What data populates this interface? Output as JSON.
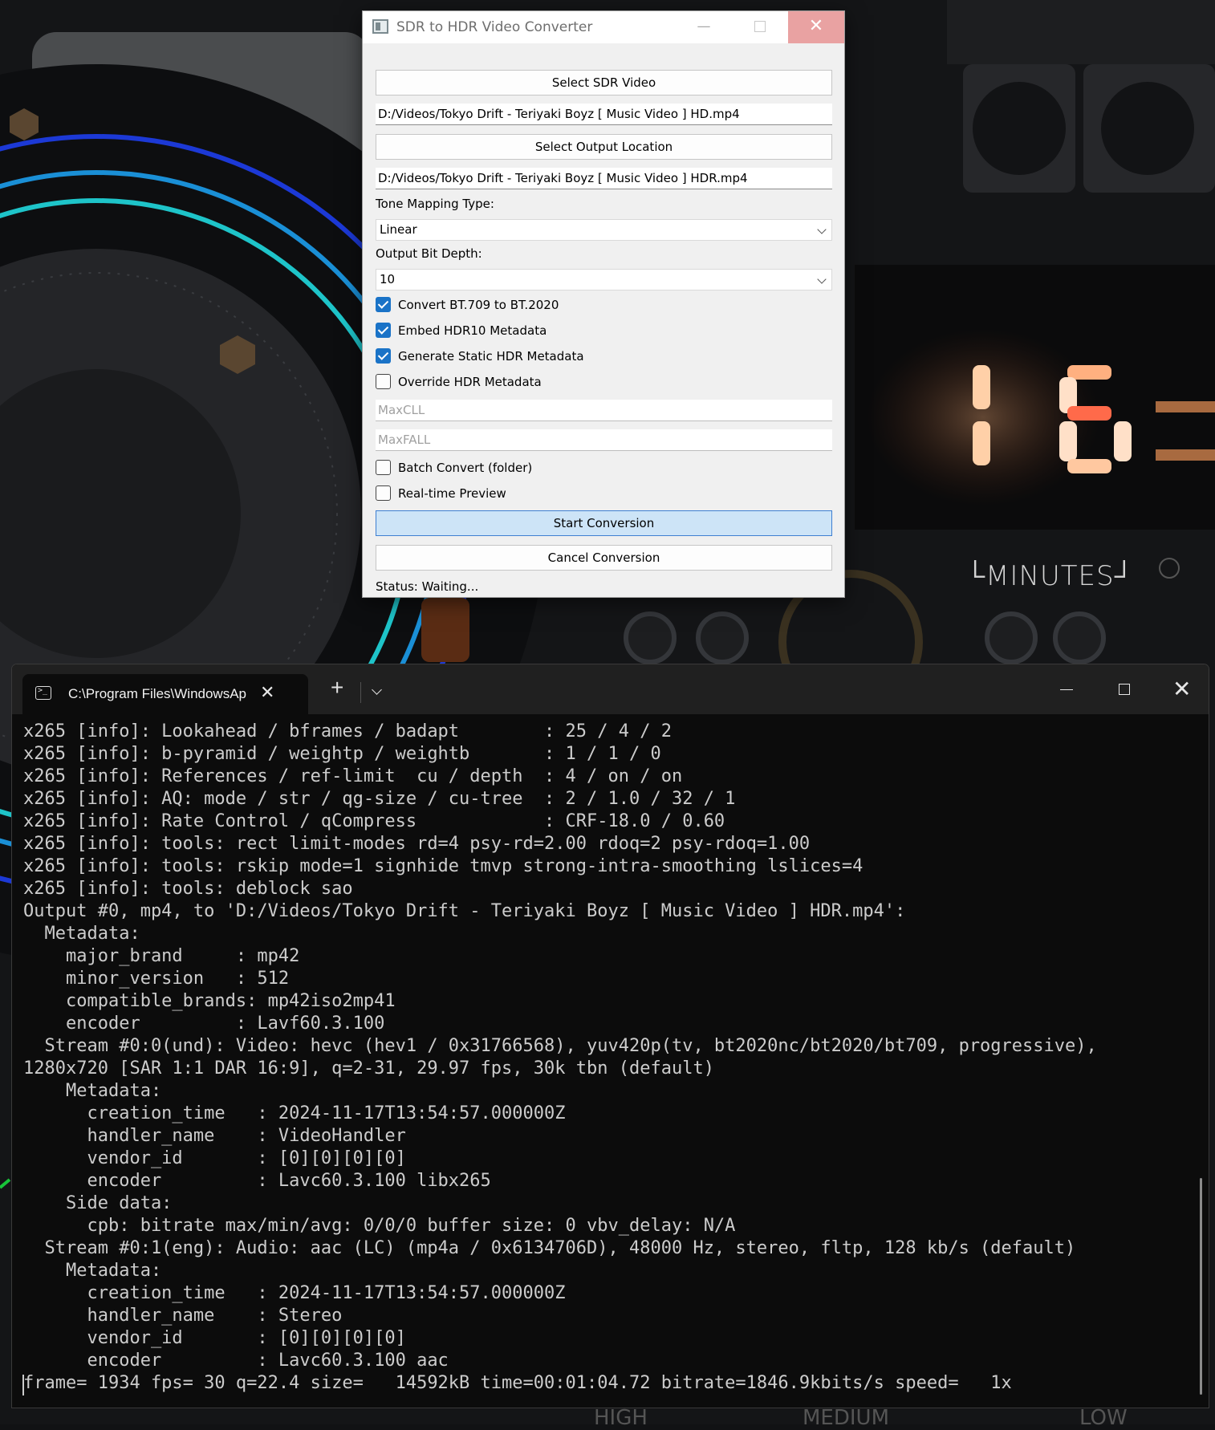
{
  "wallpaper": {
    "minutes_label": "└MINUTES┘",
    "bottom_labels": [
      "HIGH",
      "MEDIUM",
      "LOW"
    ]
  },
  "converter": {
    "title": "SDR to HDR Video Converter",
    "controls": {
      "minimize": "—",
      "close": "✕"
    },
    "select_input_button": "Select SDR Video",
    "input_path": "D:/Videos/Tokyo Drift - Teriyaki Boyz [ Music Video ] HD.mp4",
    "select_output_button": "Select Output Location",
    "output_path": "D:/Videos/Tokyo Drift - Teriyaki Boyz [ Music Video ] HDR.mp4",
    "tone_mapping_label": "Tone Mapping Type:",
    "tone_mapping_value": "Linear",
    "bit_depth_label": "Output Bit Depth:",
    "bit_depth_value": "10",
    "checkboxes": [
      {
        "label": "Convert BT.709 to BT.2020",
        "checked": true
      },
      {
        "label": "Embed HDR10 Metadata",
        "checked": true
      },
      {
        "label": "Generate Static HDR Metadata",
        "checked": true
      },
      {
        "label": "Override HDR Metadata",
        "checked": false
      }
    ],
    "maxcll_placeholder": "MaxCLL",
    "maxfall_placeholder": "MaxFALL",
    "batch_convert_label": "Batch Convert (folder)",
    "batch_convert_checked": false,
    "realtime_preview_label": "Real-time Preview",
    "realtime_preview_checked": false,
    "start_button": "Start Conversion",
    "cancel_button": "Cancel Conversion",
    "status": "Status: Waiting...",
    "accent_color": "#1a73c7"
  },
  "terminal": {
    "tab_title": "C:\\Program Files\\WindowsAp",
    "tab_close": "✕",
    "new_tab": "+",
    "close": "✕",
    "lines": [
      "x265 [info]: Lookahead / bframes / badapt        : 25 / 4 / 2",
      "x265 [info]: b-pyramid / weightp / weightb       : 1 / 1 / 0",
      "x265 [info]: References / ref-limit  cu / depth  : 4 / on / on",
      "x265 [info]: AQ: mode / str / qg-size / cu-tree  : 2 / 1.0 / 32 / 1",
      "x265 [info]: Rate Control / qCompress            : CRF-18.0 / 0.60",
      "x265 [info]: tools: rect limit-modes rd=4 psy-rd=2.00 rdoq=2 psy-rdoq=1.00",
      "x265 [info]: tools: rskip mode=1 signhide tmvp strong-intra-smoothing lslices=4",
      "x265 [info]: tools: deblock sao",
      "Output #0, mp4, to 'D:/Videos/Tokyo Drift - Teriyaki Boyz [ Music Video ] HDR.mp4':",
      "  Metadata:",
      "    major_brand     : mp42",
      "    minor_version   : 512",
      "    compatible_brands: mp42iso2mp41",
      "    encoder         : Lavf60.3.100",
      "  Stream #0:0(und): Video: hevc (hev1 / 0x31766568), yuv420p(tv, bt2020nc/bt2020/bt709, progressive),",
      "1280x720 [SAR 1:1 DAR 16:9], q=2-31, 29.97 fps, 30k tbn (default)",
      "    Metadata:",
      "      creation_time   : 2024-11-17T13:54:57.000000Z",
      "      handler_name    : VideoHandler",
      "      vendor_id       : [0][0][0][0]",
      "      encoder         : Lavc60.3.100 libx265",
      "    Side data:",
      "      cpb: bitrate max/min/avg: 0/0/0 buffer size: 0 vbv_delay: N/A",
      "  Stream #0:1(eng): Audio: aac (LC) (mp4a / 0x6134706D), 48000 Hz, stereo, fltp, 128 kb/s (default)",
      "    Metadata:",
      "      creation_time   : 2024-11-17T13:54:57.000000Z",
      "      handler_name    : Stereo",
      "      vendor_id       : [0][0][0][0]",
      "      encoder         : Lavc60.3.100 aac",
      "frame= 1934 fps= 30 q=22.4 size=   14592kB time=00:01:04.72 bitrate=1846.9kbits/s speed=   1x"
    ]
  }
}
